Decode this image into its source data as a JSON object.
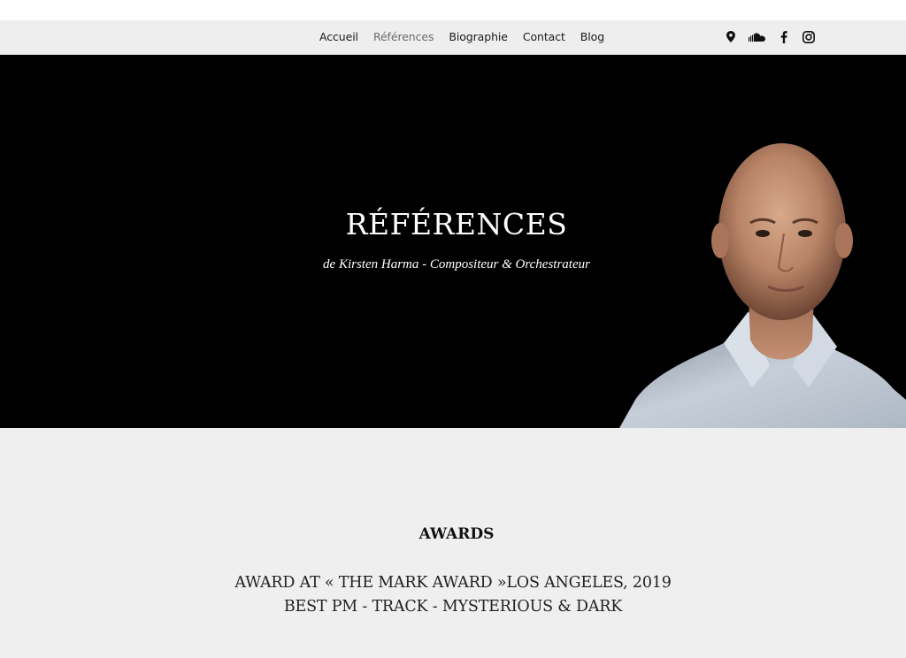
{
  "nav": {
    "items": [
      {
        "label": "Accueil",
        "active": false
      },
      {
        "label": "Références",
        "active": true
      },
      {
        "label": "Biographie",
        "active": false
      },
      {
        "label": "Contact",
        "active": false
      },
      {
        "label": "Blog",
        "active": false
      }
    ],
    "social_icons": [
      "map-pin-icon",
      "soundcloud-icon",
      "facebook-icon",
      "instagram-icon"
    ]
  },
  "hero": {
    "title": "RÉFÉRENCES",
    "subtitle": "de Kirsten Harma - Compositeur & Orchestrateur"
  },
  "awards": {
    "heading": "AWARDS",
    "lines": [
      "AWARD AT « THE MARK AWARD »LOS ANGELES, 2019",
      "BEST PM - TRACK - MYSTERIOUS & DARK"
    ]
  },
  "colors": {
    "nav_background": "#eeeeee",
    "hero_background": "#000000",
    "page_background": "#efefef",
    "text_dark": "#111111",
    "nav_active": "#6b6b6b"
  }
}
